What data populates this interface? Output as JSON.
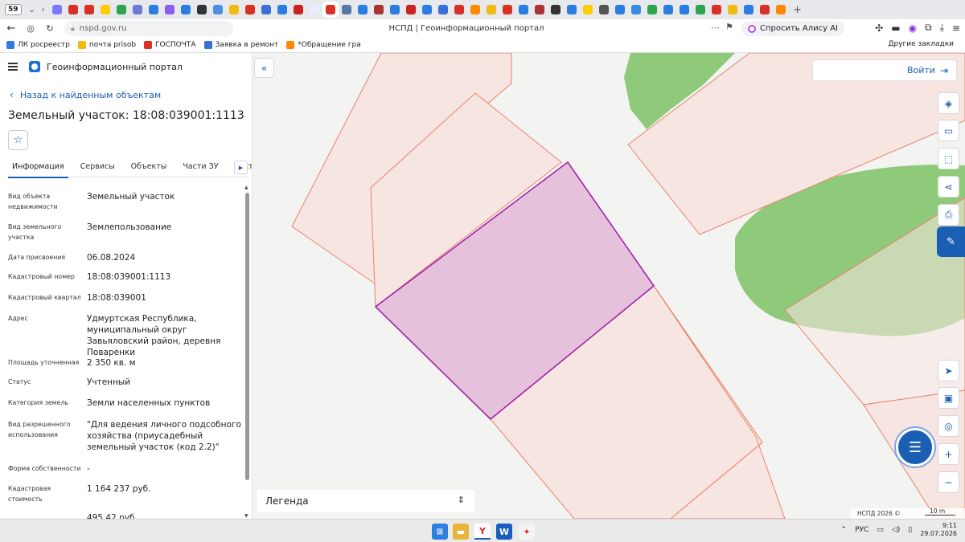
{
  "browser": {
    "tab_count": "59",
    "tab_favicons": [
      "#7a7aff",
      "#d93025",
      "#d93025",
      "#ffcc00",
      "#2da44e",
      "#6b7bd6",
      "#2a7de1",
      "#8a5cf0",
      "#2a7de1",
      "#333333",
      "#4a90e2",
      "#f2b90f",
      "#d93025",
      "#3a6fd8",
      "#2a7de1",
      "#cc2222",
      "#e8eefc",
      "#d93025",
      "#5577aa",
      "#2a7de1",
      "#aa3333",
      "#2a7de1",
      "#cc2222",
      "#2a7de1",
      "#3a6fd8",
      "#d93025",
      "#ff8800",
      "#f2b90f",
      "#d93025",
      "#2a7de1",
      "#aa3333",
      "#333333",
      "#2a7de1",
      "#ffcc00",
      "#555555",
      "#2a7de1",
      "#3a8be3",
      "#2da44e",
      "#2a7de1",
      "#2a7de1",
      "#2da44e",
      "#d93025",
      "#f2b90f",
      "#2a7de1",
      "#d93025",
      "#ff8800"
    ],
    "active_tab_index": 17,
    "url": "nspd.gov.ru",
    "page_title": "НСПД | Геоинформационный портал",
    "alice_label": "Спросить Алису AI",
    "bookmarks": [
      {
        "label": "ЛК росреестр",
        "color": "#2a7de1"
      },
      {
        "label": "почта prisob",
        "color": "#f2b90f"
      },
      {
        "label": "ГОСПОЧТА",
        "color": "#d93025"
      },
      {
        "label": "Заявка в ремонт",
        "color": "#3a6fd8"
      },
      {
        "label": "*Обращение гра",
        "color": "#ff8800"
      }
    ],
    "other_bookmarks": "Другие закладки"
  },
  "panel": {
    "portal_name": "Геоинформационный портал",
    "back_link": "Назад к найденным объектам",
    "object_title": "Земельный участок: 18:08:039001:1113",
    "tabs": [
      "Информация",
      "Сервисы",
      "Объекты",
      "Части ЗУ",
      "Состав"
    ],
    "attributes": [
      {
        "label": "Вид объекта недвижимости",
        "value": "Земельный участок"
      },
      {
        "label": "Вид земельного участка",
        "value": "Землепользование"
      },
      {
        "label": "Дата присвоения",
        "value": "06.08.2024"
      },
      {
        "label": "Кадастровый номер",
        "value": "18:08:039001:1113"
      },
      {
        "label": "Кадастровый квартал",
        "value": "18:08:039001"
      },
      {
        "label": "Адрес",
        "value": "Удмуртская Республика, муниципальный округ Завьяловский район, деревня Поваренки"
      },
      {
        "label": "Площадь уточненная",
        "value": "2 350 кв. м"
      },
      {
        "label": "Статус",
        "value": "Учтенный"
      },
      {
        "label": "Категория земель",
        "value": "Земли населенных пунктов"
      },
      {
        "label": "Вид разрешенного использования",
        "value": "\"Для ведения личного подсобного хозяйства (приусадебный земельный участок (код 2.2)\""
      },
      {
        "label": "Форма собственности",
        "value": "-"
      },
      {
        "label": "Кадастровая стоимость",
        "value": "1 164 237 руб."
      },
      {
        "label": "",
        "value": "495,42 руб."
      }
    ]
  },
  "map": {
    "login_label": "Войти",
    "legend_label": "Легенда",
    "attribution": "НСПД 2026 ©",
    "scale_label": "10 m",
    "colors": {
      "parcel_fill": "#f7e5e2",
      "parcel_stroke": "#e8836a",
      "selected_fill": "#e5c1dc",
      "selected_stroke": "#a025a8",
      "vegetation": "#8fc97a"
    }
  },
  "taskbar": {
    "language": "РУС",
    "time": "9:11",
    "date": "29.07.2026"
  }
}
